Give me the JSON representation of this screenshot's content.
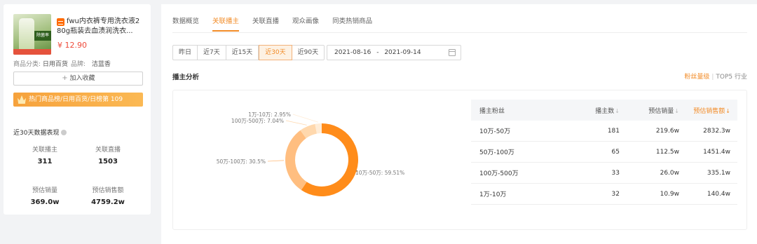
{
  "product": {
    "title": "fwu内衣裤专用洗衣液280g瓶装去血渍润洗衣...",
    "price": "¥ 12.90",
    "category_label": "商品分类:",
    "category_value": "日用百货",
    "brand_label": "品牌:",
    "brand_value": "洁蓝香",
    "favorite_label": "加入收藏",
    "rank_text": "热门商品榜/日用百货/日榜第 109",
    "thumb_tag": "除菌率"
  },
  "recent": {
    "title": "近30天数据表现",
    "stats": [
      {
        "label": "关联播主",
        "value": "311"
      },
      {
        "label": "关联直播",
        "value": "1503"
      },
      {
        "label": "预估销量",
        "value": "369.0w"
      },
      {
        "label": "预估销售额",
        "value": "4759.2w"
      }
    ]
  },
  "tabs": [
    "数据概览",
    "关联播主",
    "关联直播",
    "观众画像",
    "同类热销商品"
  ],
  "active_tab": "关联播主",
  "ranges": [
    "昨日",
    "近7天",
    "近15天",
    "近30天",
    "近90天"
  ],
  "active_range": "近30天",
  "date_range": {
    "start": "2021-08-16",
    "sep": "-",
    "end": "2021-09-14"
  },
  "section_title": "播主分析",
  "switch": {
    "left": "粉丝量级",
    "sep": "|",
    "right": "TOP5 行业"
  },
  "colors": {
    "accent": "#f28c28",
    "price": "#ee4a3a"
  },
  "chart_data": {
    "type": "pie",
    "categories": [
      "10万-50万",
      "50万-100万",
      "100万-500万",
      "1万-10万"
    ],
    "values": [
      59.51,
      30.5,
      7.04,
      2.95
    ],
    "value_labels": [
      "10万-50万: 59.51%",
      "50万-100万: 30.5%",
      "100万-500万: 7.04%",
      "1万-10万: 2.95%"
    ],
    "colors": [
      "#ff8c1a",
      "#ffbe80",
      "#ffd8ad",
      "#ffecd6"
    ],
    "donut": true
  },
  "table": {
    "headers": [
      "播主粉丝",
      "播主数",
      "预估销量",
      "预估销售额"
    ],
    "rows": [
      [
        "10万-50万",
        "181",
        "219.6w",
        "2832.3w"
      ],
      [
        "50万-100万",
        "65",
        "112.5w",
        "1451.4w"
      ],
      [
        "100万-500万",
        "33",
        "26.0w",
        "335.1w"
      ],
      [
        "1万-10万",
        "32",
        "10.9w",
        "140.4w"
      ]
    ]
  }
}
